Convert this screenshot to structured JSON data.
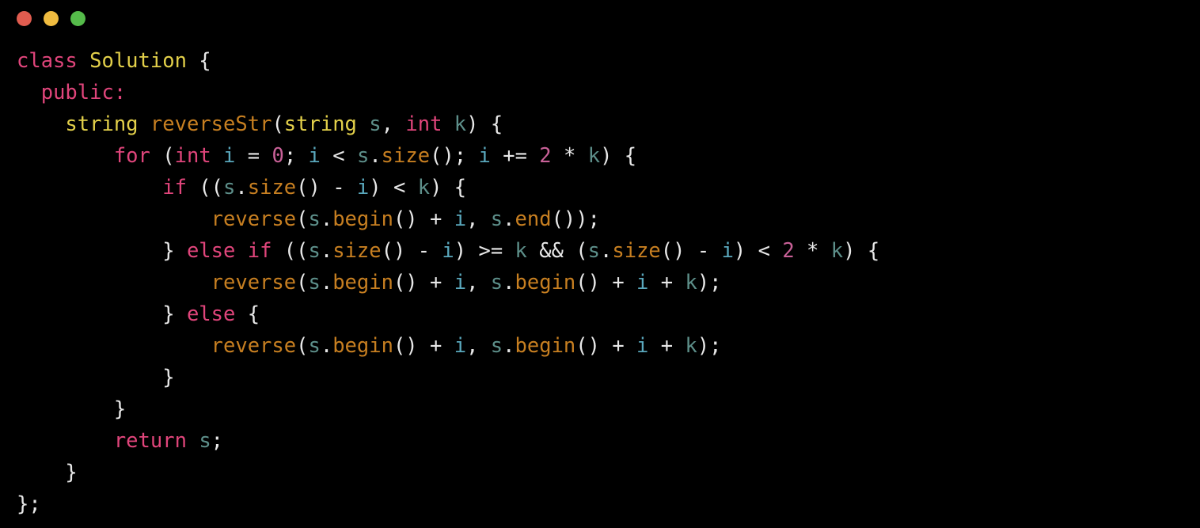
{
  "window": {
    "title": "",
    "background_color": "#000000",
    "traffic_lights": [
      {
        "name": "close-button",
        "label": "Close",
        "color": "#e05c4f"
      },
      {
        "name": "minimize-button",
        "label": "Minimize",
        "color": "#f0bc40"
      },
      {
        "name": "maximize-button",
        "label": "Maximize",
        "color": "#55bb4a"
      }
    ]
  },
  "editor": {
    "language": "C++",
    "font_size_px": 25.5,
    "line_height_px": 40,
    "default_text_color": "#e8e8e8",
    "palette": {
      "keyword": "#e0457b",
      "type": "#e3d04a",
      "function": "#c77f21",
      "variable": "#5d8f8a",
      "parameter_i": "#5aa8bd",
      "number": "#c96198",
      "punctuation": "#e8e8e8"
    },
    "plain_text": "class Solution {\n  public:\n    string reverseStr(string s, int k) {\n        for (int i = 0; i < s.size(); i += 2 * k) {\n            if ((s.size() - i) < k) {\n                reverse(s.begin() + i, s.end());\n            } else if ((s.size() - i) >= k && (s.size() - i) < 2 * k) {\n                reverse(s.begin() + i, s.begin() + i + k);\n            } else {\n                reverse(s.begin() + i, s.begin() + i + k);\n            }\n        }\n        return s;\n    }\n};",
    "lines": [
      [
        {
          "t": "class",
          "c": "keyword"
        },
        {
          "t": " ",
          "c": "punctuation"
        },
        {
          "t": "Solution",
          "c": "type"
        },
        {
          "t": " {",
          "c": "punctuation"
        }
      ],
      [
        {
          "t": "  ",
          "c": "punctuation"
        },
        {
          "t": "public",
          "c": "keyword"
        },
        {
          "t": ":",
          "c": "keyword"
        }
      ],
      [
        {
          "t": "    ",
          "c": "punctuation"
        },
        {
          "t": "string",
          "c": "type"
        },
        {
          "t": " ",
          "c": "punctuation"
        },
        {
          "t": "reverseStr",
          "c": "function"
        },
        {
          "t": "(",
          "c": "punctuation"
        },
        {
          "t": "string",
          "c": "type"
        },
        {
          "t": " ",
          "c": "punctuation"
        },
        {
          "t": "s",
          "c": "variable"
        },
        {
          "t": ", ",
          "c": "punctuation"
        },
        {
          "t": "int",
          "c": "keyword"
        },
        {
          "t": " ",
          "c": "punctuation"
        },
        {
          "t": "k",
          "c": "variable"
        },
        {
          "t": ") {",
          "c": "punctuation"
        }
      ],
      [
        {
          "t": "        ",
          "c": "punctuation"
        },
        {
          "t": "for",
          "c": "keyword"
        },
        {
          "t": " (",
          "c": "punctuation"
        },
        {
          "t": "int",
          "c": "keyword"
        },
        {
          "t": " ",
          "c": "punctuation"
        },
        {
          "t": "i",
          "c": "parameter_i"
        },
        {
          "t": " = ",
          "c": "punctuation"
        },
        {
          "t": "0",
          "c": "number"
        },
        {
          "t": "; ",
          "c": "punctuation"
        },
        {
          "t": "i",
          "c": "parameter_i"
        },
        {
          "t": " < ",
          "c": "punctuation"
        },
        {
          "t": "s",
          "c": "variable"
        },
        {
          "t": ".",
          "c": "punctuation"
        },
        {
          "t": "size",
          "c": "function"
        },
        {
          "t": "(); ",
          "c": "punctuation"
        },
        {
          "t": "i",
          "c": "parameter_i"
        },
        {
          "t": " += ",
          "c": "punctuation"
        },
        {
          "t": "2",
          "c": "number"
        },
        {
          "t": " * ",
          "c": "punctuation"
        },
        {
          "t": "k",
          "c": "variable"
        },
        {
          "t": ") {",
          "c": "punctuation"
        }
      ],
      [
        {
          "t": "            ",
          "c": "punctuation"
        },
        {
          "t": "if",
          "c": "keyword"
        },
        {
          "t": " ((",
          "c": "punctuation"
        },
        {
          "t": "s",
          "c": "variable"
        },
        {
          "t": ".",
          "c": "punctuation"
        },
        {
          "t": "size",
          "c": "function"
        },
        {
          "t": "() - ",
          "c": "punctuation"
        },
        {
          "t": "i",
          "c": "parameter_i"
        },
        {
          "t": ") < ",
          "c": "punctuation"
        },
        {
          "t": "k",
          "c": "variable"
        },
        {
          "t": ") {",
          "c": "punctuation"
        }
      ],
      [
        {
          "t": "                ",
          "c": "punctuation"
        },
        {
          "t": "reverse",
          "c": "function"
        },
        {
          "t": "(",
          "c": "punctuation"
        },
        {
          "t": "s",
          "c": "variable"
        },
        {
          "t": ".",
          "c": "punctuation"
        },
        {
          "t": "begin",
          "c": "function"
        },
        {
          "t": "() + ",
          "c": "punctuation"
        },
        {
          "t": "i",
          "c": "parameter_i"
        },
        {
          "t": ", ",
          "c": "punctuation"
        },
        {
          "t": "s",
          "c": "variable"
        },
        {
          "t": ".",
          "c": "punctuation"
        },
        {
          "t": "end",
          "c": "function"
        },
        {
          "t": "());",
          "c": "punctuation"
        }
      ],
      [
        {
          "t": "            } ",
          "c": "punctuation"
        },
        {
          "t": "else",
          "c": "keyword"
        },
        {
          "t": " ",
          "c": "punctuation"
        },
        {
          "t": "if",
          "c": "keyword"
        },
        {
          "t": " ((",
          "c": "punctuation"
        },
        {
          "t": "s",
          "c": "variable"
        },
        {
          "t": ".",
          "c": "punctuation"
        },
        {
          "t": "size",
          "c": "function"
        },
        {
          "t": "() - ",
          "c": "punctuation"
        },
        {
          "t": "i",
          "c": "parameter_i"
        },
        {
          "t": ") >= ",
          "c": "punctuation"
        },
        {
          "t": "k",
          "c": "variable"
        },
        {
          "t": " && (",
          "c": "punctuation"
        },
        {
          "t": "s",
          "c": "variable"
        },
        {
          "t": ".",
          "c": "punctuation"
        },
        {
          "t": "size",
          "c": "function"
        },
        {
          "t": "() - ",
          "c": "punctuation"
        },
        {
          "t": "i",
          "c": "parameter_i"
        },
        {
          "t": ") < ",
          "c": "punctuation"
        },
        {
          "t": "2",
          "c": "number"
        },
        {
          "t": " * ",
          "c": "punctuation"
        },
        {
          "t": "k",
          "c": "variable"
        },
        {
          "t": ") {",
          "c": "punctuation"
        }
      ],
      [
        {
          "t": "                ",
          "c": "punctuation"
        },
        {
          "t": "reverse",
          "c": "function"
        },
        {
          "t": "(",
          "c": "punctuation"
        },
        {
          "t": "s",
          "c": "variable"
        },
        {
          "t": ".",
          "c": "punctuation"
        },
        {
          "t": "begin",
          "c": "function"
        },
        {
          "t": "() + ",
          "c": "punctuation"
        },
        {
          "t": "i",
          "c": "parameter_i"
        },
        {
          "t": ", ",
          "c": "punctuation"
        },
        {
          "t": "s",
          "c": "variable"
        },
        {
          "t": ".",
          "c": "punctuation"
        },
        {
          "t": "begin",
          "c": "function"
        },
        {
          "t": "() + ",
          "c": "punctuation"
        },
        {
          "t": "i",
          "c": "parameter_i"
        },
        {
          "t": " + ",
          "c": "punctuation"
        },
        {
          "t": "k",
          "c": "variable"
        },
        {
          "t": ");",
          "c": "punctuation"
        }
      ],
      [
        {
          "t": "            } ",
          "c": "punctuation"
        },
        {
          "t": "else",
          "c": "keyword"
        },
        {
          "t": " {",
          "c": "punctuation"
        }
      ],
      [
        {
          "t": "                ",
          "c": "punctuation"
        },
        {
          "t": "reverse",
          "c": "function"
        },
        {
          "t": "(",
          "c": "punctuation"
        },
        {
          "t": "s",
          "c": "variable"
        },
        {
          "t": ".",
          "c": "punctuation"
        },
        {
          "t": "begin",
          "c": "function"
        },
        {
          "t": "() + ",
          "c": "punctuation"
        },
        {
          "t": "i",
          "c": "parameter_i"
        },
        {
          "t": ", ",
          "c": "punctuation"
        },
        {
          "t": "s",
          "c": "variable"
        },
        {
          "t": ".",
          "c": "punctuation"
        },
        {
          "t": "begin",
          "c": "function"
        },
        {
          "t": "() + ",
          "c": "punctuation"
        },
        {
          "t": "i",
          "c": "parameter_i"
        },
        {
          "t": " + ",
          "c": "punctuation"
        },
        {
          "t": "k",
          "c": "variable"
        },
        {
          "t": ");",
          "c": "punctuation"
        }
      ],
      [
        {
          "t": "            }",
          "c": "punctuation"
        }
      ],
      [
        {
          "t": "        }",
          "c": "punctuation"
        }
      ],
      [
        {
          "t": "        ",
          "c": "punctuation"
        },
        {
          "t": "return",
          "c": "keyword"
        },
        {
          "t": " ",
          "c": "punctuation"
        },
        {
          "t": "s",
          "c": "variable"
        },
        {
          "t": ";",
          "c": "punctuation"
        }
      ],
      [
        {
          "t": "    }",
          "c": "punctuation"
        }
      ],
      [
        {
          "t": "};",
          "c": "punctuation"
        }
      ]
    ]
  }
}
